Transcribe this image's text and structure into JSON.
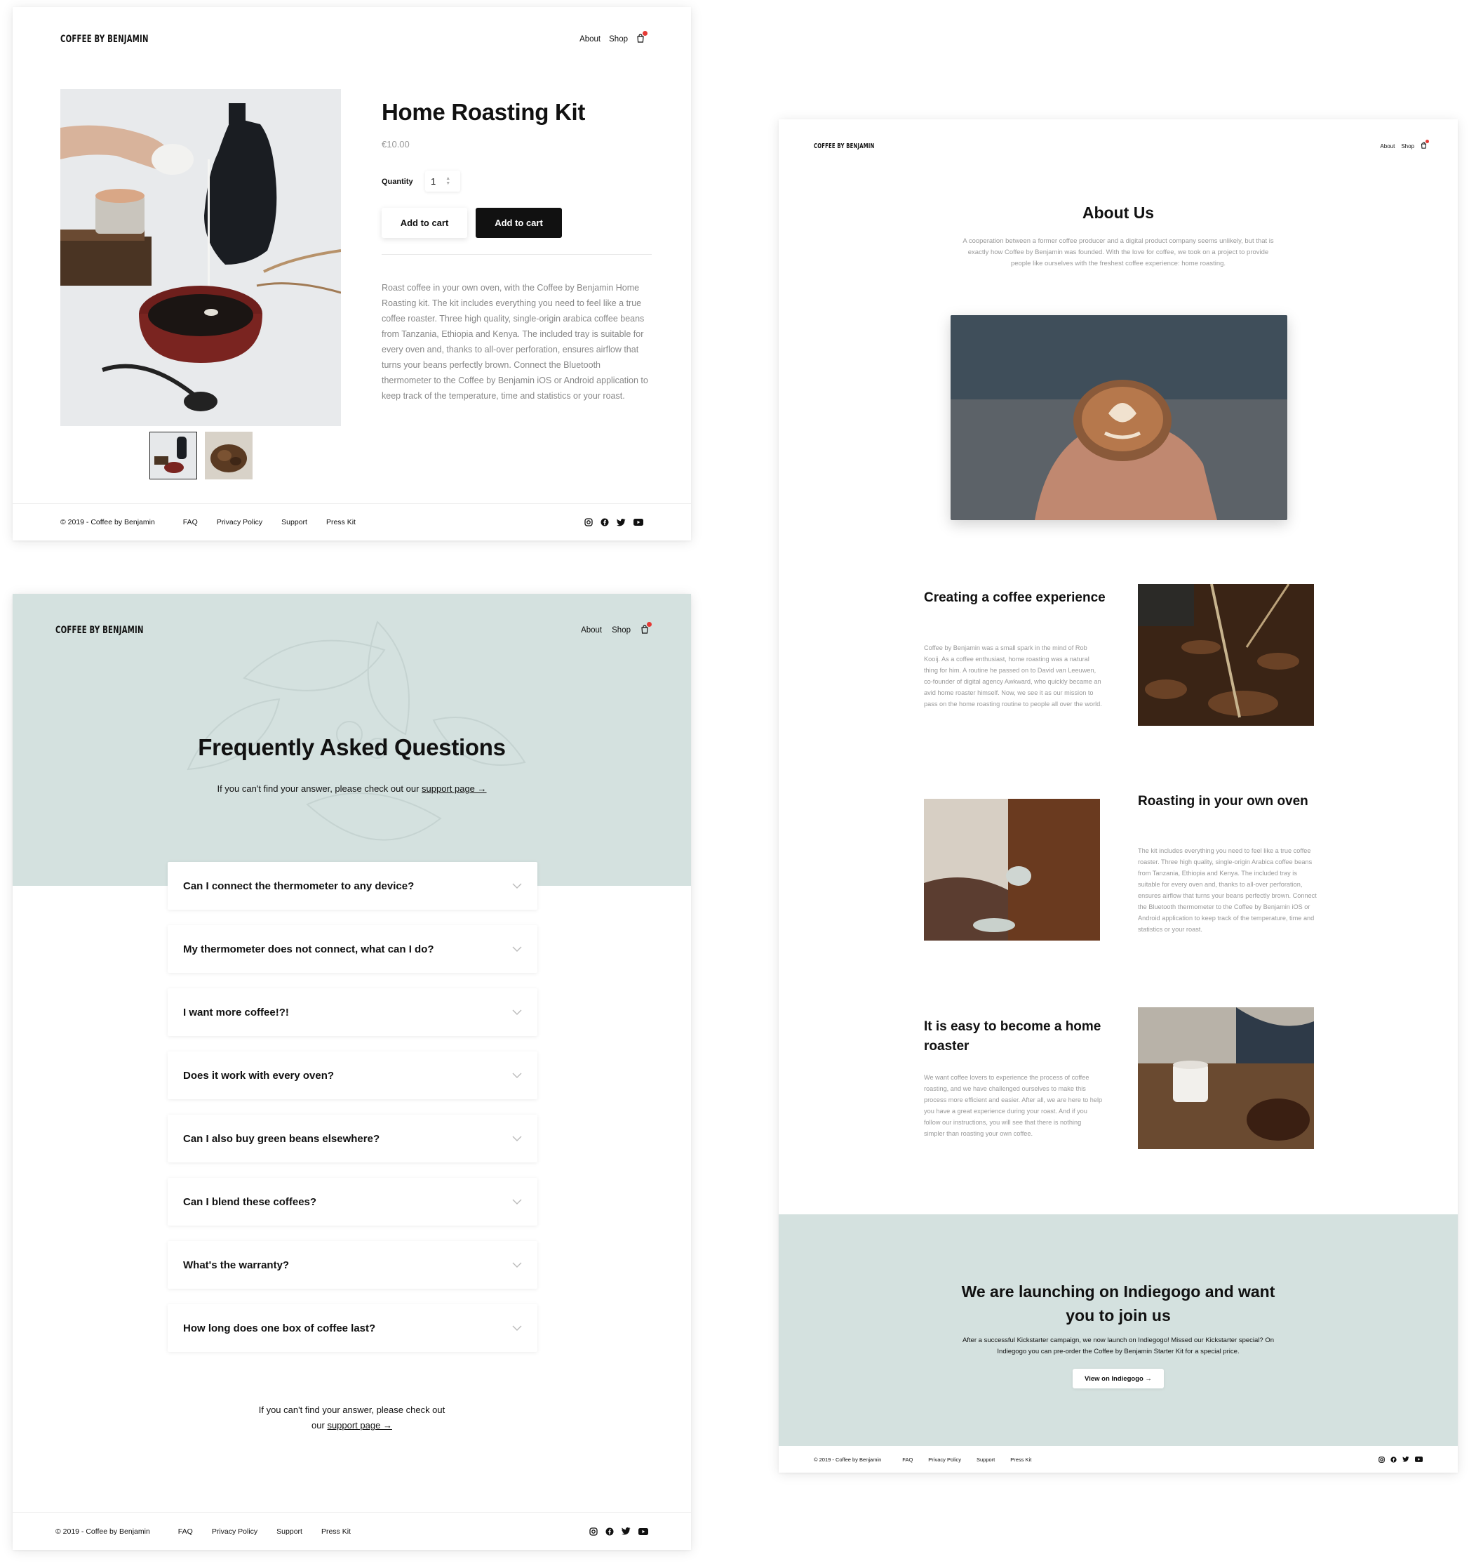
{
  "brand": "COFFEE BY BENJAMIN",
  "nav": {
    "about": "About",
    "shop": "Shop"
  },
  "footer": {
    "copyright": "© 2019 - Coffee by Benjamin",
    "links": [
      "FAQ",
      "Privacy Policy",
      "Support",
      "Press Kit"
    ]
  },
  "social_icons": [
    "instagram-icon",
    "facebook-icon",
    "twitter-icon",
    "youtube-icon"
  ],
  "colors": {
    "accent_bg": "#d4e1df",
    "cart_badge": "#e53935",
    "button_dark": "#111111"
  },
  "product": {
    "title": "Home Roasting Kit",
    "price": "€10.00",
    "quantity_label": "Quantity",
    "quantity_value": "1",
    "add_to_cart_light": "Add to cart",
    "add_to_cart_dark": "Add to cart",
    "description": "Roast coffee in your own oven, with the Coffee by Benjamin Home Roasting kit. The kit includes everything you need to feel like a true coffee roaster. Three high quality, single-origin arabica coffee beans from Tanzania, Ethiopia and Kenya. The included tray is suitable for every oven and, thanks to all-over perforation, ensures airflow that turns your beans perfectly brown. Connect the Bluetooth thermometer to the Coffee by Benjamin iOS or Android application to keep track of the temperature, time and statistics or your roast."
  },
  "faq": {
    "title": "Frequently Asked Questions",
    "subtitle_text": "If you can't find your answer, please check out our ",
    "support_link": "support page →",
    "questions": [
      "Can I connect the thermometer to any device?",
      "My thermometer does not connect, what can I do?",
      "I want more coffee!?!",
      "Does it work with every oven?",
      "Can I also buy green beans elsewhere?",
      "Can I blend these coffees?",
      "What's the warranty?",
      "How long does one box of coffee last?"
    ],
    "bottom_line1": "If you can't find your answer, please check out",
    "bottom_line2_prefix": "our ",
    "bottom_link": "support page →"
  },
  "about": {
    "title": "About Us",
    "intro": "A cooperation between a former coffee producer and a digital product company seems unlikely, but that is exactly how Coffee by Benjamin was founded. With the love for coffee, we took on a project to provide people like ourselves with the freshest coffee experience: home roasting.",
    "sections": [
      {
        "title": "Creating a coffee experience",
        "text": "Coffee by Benjamin was a small spark in the mind of Rob Kooij. As a coffee enthusiast, home roasting was a natural thing for him. A routine he passed on to David van Leeuwen, co-founder of digital agency Awkward, who quickly became an avid home roaster himself. Now, we see it as our mission to pass on the home roasting routine to people all over the world."
      },
      {
        "title": "Roasting in your own oven",
        "text": "The kit includes everything you need to feel like a true coffee roaster. Three high quality, single-origin Arabica coffee beans from Tanzania, Ethiopia and Kenya. The included tray is suitable for every oven and, thanks to all-over perforation, ensures airflow that turns your beans perfectly brown. Connect the Bluetooth thermometer to the Coffee by Benjamin iOS or Android application to keep track of the temperature, time and statistics or your roast."
      },
      {
        "title": "It is easy to become a home roaster",
        "text": "We want coffee lovers to experience the process of coffee roasting, and we have challenged ourselves to make this process more efficient and easier. After all, we are here to help you have a great experience during your roast. And if you follow our instructions, you will see that there is nothing simpler than roasting your own coffee."
      }
    ],
    "banner": {
      "title": "We are launching on Indiegogo and want you to join us",
      "text": "After a successful Kickstarter campaign, we now launch on Indiegogo! Missed our Kickstarter special? On Indiegogo you can pre-order the Coffee by Benjamin Starter Kit for a special price.",
      "button": "View on Indiegogo →"
    }
  }
}
